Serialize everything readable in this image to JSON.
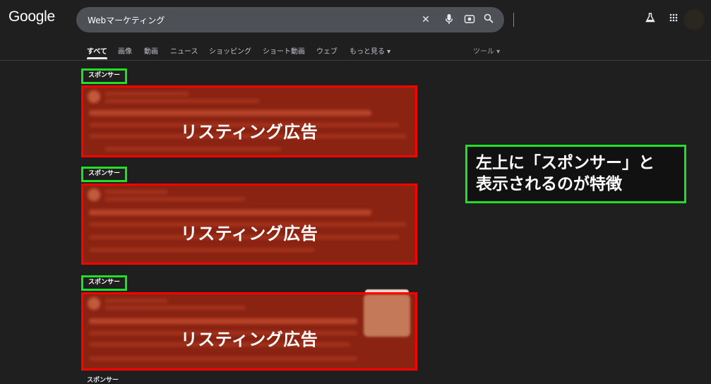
{
  "header": {
    "logo": "Google",
    "search_query": "Webマーケティング",
    "icons": [
      "close-icon",
      "mic-icon",
      "lens-icon",
      "search-icon",
      "labs-icon",
      "apps-icon"
    ]
  },
  "tabs": [
    {
      "label": "すべて",
      "active": true
    },
    {
      "label": "画像"
    },
    {
      "label": "動画"
    },
    {
      "label": "ニュース"
    },
    {
      "label": "ショッピング"
    },
    {
      "label": "ショート動画"
    },
    {
      "label": "ウェブ"
    },
    {
      "label": "もっと見る ▾"
    }
  ],
  "tools_label": "ツール ▾",
  "ads": [
    {
      "sponsor_label": "スポンサー",
      "overlay_label": "リスティング広告"
    },
    {
      "sponsor_label": "スポンサー",
      "overlay_label": "リスティング広告"
    },
    {
      "sponsor_label": "スポンサー",
      "overlay_label": "リスティング広告"
    }
  ],
  "next_sponsor_label": "スポンサー",
  "callout": {
    "line1": "左上に「スポンサー」と",
    "line2": "表示されるのが特徴"
  },
  "colors": {
    "highlight_green": "#1ee024",
    "ad_border_red": "#ff0000",
    "ad_fill": "#8a2312",
    "background": "#1f1f1f"
  }
}
